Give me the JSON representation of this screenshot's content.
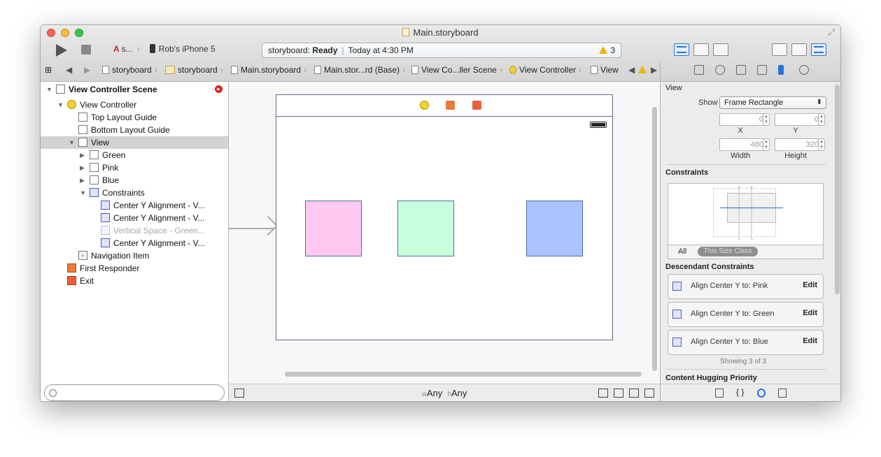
{
  "window": {
    "title": "Main.storyboard"
  },
  "toolbar": {
    "scheme_label": "s...",
    "device_label": "Rob's iPhone 5",
    "activity_prefix": "storyboard:",
    "activity_status": "Ready",
    "activity_time": "Today at 4:30 PM",
    "warning_count": "3"
  },
  "jumpbar": {
    "items": [
      "storyboard",
      "storyboard",
      "Main.storyboard",
      "Main.stor...rd (Base)",
      "View Co...ller Scene",
      "View Controller",
      "View"
    ]
  },
  "navigator": {
    "rows": [
      {
        "label": "View Controller Scene"
      },
      {
        "label": "View Controller"
      },
      {
        "label": "Top Layout Guide"
      },
      {
        "label": "Bottom Layout Guide"
      },
      {
        "label": "View"
      },
      {
        "label": "Green"
      },
      {
        "label": "Pink"
      },
      {
        "label": "Blue"
      },
      {
        "label": "Constraints"
      },
      {
        "label": "Center Y Alignment - V..."
      },
      {
        "label": "Center Y Alignment - V..."
      },
      {
        "label": "Vertical Space - Green..."
      },
      {
        "label": "Center Y Alignment - V..."
      },
      {
        "label": "Navigation Item"
      },
      {
        "label": "First Responder"
      },
      {
        "label": "Exit"
      }
    ],
    "filter_placeholder": ""
  },
  "canvas": {
    "boxes": [
      {
        "name": "pink-view",
        "color": "#ffc8f0"
      },
      {
        "name": "green-view",
        "color": "#c8ffdc"
      },
      {
        "name": "blue-view",
        "color": "#a9c4ff"
      }
    ],
    "size_class_w_prefix": "w",
    "size_class_w": "Any",
    "size_class_h_prefix": "h",
    "size_class_h": "Any"
  },
  "inspector": {
    "section_view": "View",
    "show_label": "Show",
    "show_value": "Frame Rectangle",
    "x_value": "0",
    "y_value": "0",
    "x_label": "X",
    "y_label": "Y",
    "width_value": "480",
    "height_value": "320",
    "width_label": "Width",
    "height_label": "Height",
    "section_constraints": "Constraints",
    "all_label": "All",
    "size_class_label": "This Size Class",
    "section_descendant": "Descendant Constraints",
    "constraints": [
      {
        "text": "Align Center Y to:  Pink",
        "edit": "Edit"
      },
      {
        "text": "Align Center Y to:  Green",
        "edit": "Edit"
      },
      {
        "text": "Align Center Y to:  Blue",
        "edit": "Edit"
      }
    ],
    "showing": "Showing 3 of 3",
    "section_hugging": "Content Hugging Priority"
  },
  "colors": {
    "accent": "#2a73d8",
    "scene_border": "#6b6486",
    "warning": "#f0b400"
  }
}
